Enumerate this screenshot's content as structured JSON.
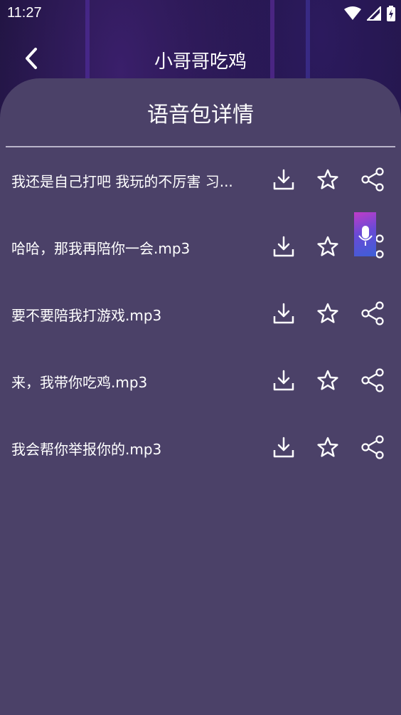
{
  "status_bar": {
    "time": "11:27"
  },
  "header": {
    "title": "小哥哥吃鸡"
  },
  "card": {
    "title": "语音包详情"
  },
  "items": [
    {
      "name": "我还是自己打吧 我玩的不厉害 习..."
    },
    {
      "name": "哈哈，那我再陪你一会.mp3"
    },
    {
      "name": "要不要陪我打游戏.mp3"
    },
    {
      "name": "来，我带你吃鸡.mp3"
    },
    {
      "name": "我会帮你举报你的.mp3"
    }
  ],
  "icons": {
    "back": "chevron-left-icon",
    "download": "download-icon",
    "favorite": "star-outline-icon",
    "share": "share-icon",
    "floating": "microphone-icon"
  },
  "colors": {
    "card_bg": "#4b4168",
    "text": "#ffffff",
    "divider": "#b9b4c9"
  }
}
